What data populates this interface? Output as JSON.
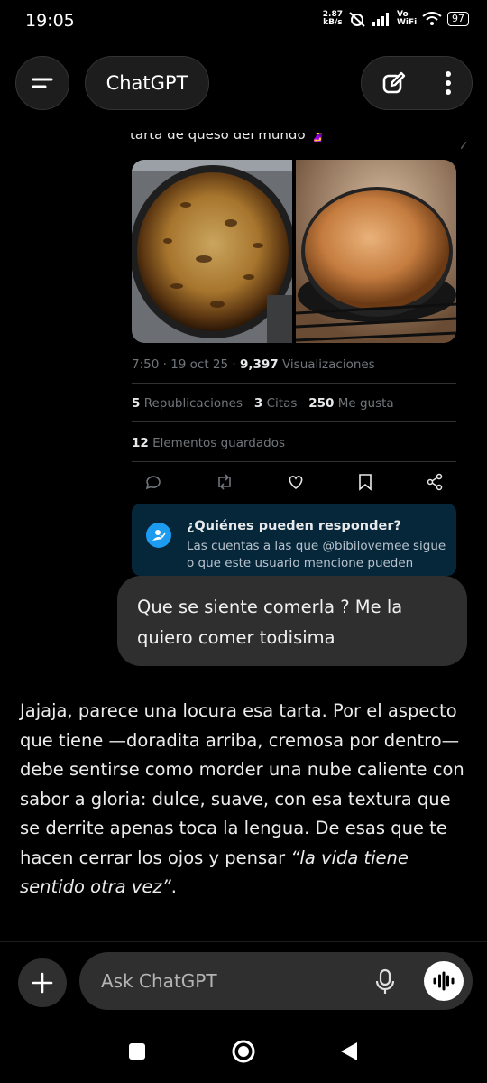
{
  "status_bar": {
    "time": "19:05",
    "net_speed": "2.87",
    "net_unit": "kB/s",
    "vowifi": "Vo WiFi",
    "battery": "97"
  },
  "header": {
    "title": "ChatGPT",
    "menu_icon": "hamburger-icon",
    "new_chat_icon": "edit-icon",
    "more_icon": "kebab-icon"
  },
  "tweet": {
    "cut_text": "tarta de queso del mundo 🤰",
    "time": "7:50 · 19 oct 25 · ",
    "views_count": "9,397",
    "views_label": " Visualizaciones",
    "reposts_count": "5",
    "reposts_label": "Republicaciones",
    "quotes_count": "3",
    "quotes_label": "Citas",
    "likes_count": "250",
    "likes_label": "Me gusta",
    "saved_count": "12",
    "saved_label": "Elementos guardados",
    "reply_box_title": "¿Quiénes pueden responder?",
    "reply_box_line1": "Las cuentas a las que @bibilovemee sigue",
    "reply_box_line2": "o que este usuario mencione pueden"
  },
  "user_message": "Que se siente comerla ? Me la quiero comer todisima",
  "assistant_message": {
    "text": "Jajaja, parece una locura esa tarta. Por el aspecto que tiene —doradita arriba, cremosa por dentro— debe sentirse como morder una nube caliente con sabor a gloria: dulce, suave, con esa textura que se derrite apenas toca la lengua. De esas que te hacen cerrar los ojos y pensar ",
    "italic": "“la vida tiene sentido otra vez”",
    "end": "."
  },
  "composer": {
    "placeholder": "Ask ChatGPT"
  }
}
